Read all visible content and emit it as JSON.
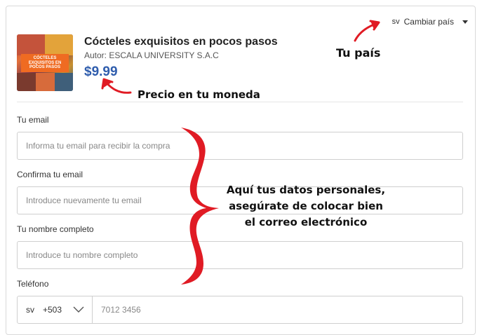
{
  "header": {
    "country_code": "sv",
    "country_link": "Cambiar país"
  },
  "product": {
    "image_text": "CÓCTELES EXQUISITOS EN POCOS PASOS",
    "title": "Cócteles exquisitos en pocos pasos",
    "author": "Autor: ESCALA UNIVERSITY S.A.C",
    "price": "$9.99"
  },
  "form": {
    "email": {
      "label": "Tu email",
      "placeholder": "Informa tu email para recibir la compra",
      "value": ""
    },
    "confirm_email": {
      "label": "Confirma tu email",
      "placeholder": "Introduce nuevamente tu email",
      "value": ""
    },
    "full_name": {
      "label": "Tu nombre completo",
      "placeholder": "Introduce tu nombre completo",
      "value": ""
    },
    "phone": {
      "label": "Teléfono",
      "country_code": "sv",
      "dial_code": "+503",
      "placeholder": "7012 3456",
      "value": ""
    }
  },
  "annotations": {
    "country": "Tu país",
    "price": "Precio en tu moneda",
    "data_line1": "Aquí tus datos personales,",
    "data_line2": "asegúrate de colocar bien",
    "data_line3": "el correo electrónico"
  },
  "colors": {
    "price": "#2f5dad",
    "annotation_arrow": "#e01b24",
    "image_banner": "#ef6b22"
  }
}
